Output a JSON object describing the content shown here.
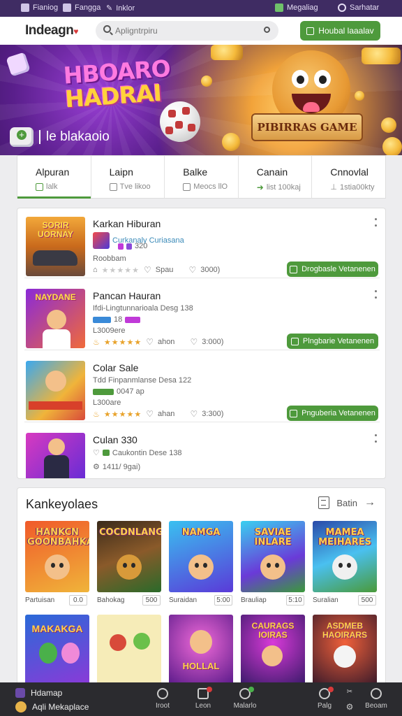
{
  "topbar": {
    "left_items": [
      "Fianiog",
      "Fangga",
      "Inklor"
    ],
    "right_items": [
      "Megaliag",
      "Sarhatar"
    ]
  },
  "header": {
    "logo": "Indeagn",
    "search_placeholder": "Apligntrpiru",
    "action_button": "Houbal laaalav"
  },
  "banner": {
    "title_line1": "HBOARO",
    "title_line2": "HADRAI",
    "tagline": "le blakaoio",
    "ribbon_text": "PIBIRRAS GAME"
  },
  "tabs": [
    {
      "label": "Alpuran",
      "sub": "lalk"
    },
    {
      "label": "Laipn",
      "sub": "Tve likoo"
    },
    {
      "label": "Balke",
      "sub": "Meocs llO"
    },
    {
      "label": "Canain",
      "sub": "list 100kaj"
    },
    {
      "label": "Cnnovlal",
      "sub": "1stia00kty"
    }
  ],
  "listings": [
    {
      "title": "Karkan Hiburan",
      "thumb_text": "SORIR UORNAY",
      "studio": "Curkanaly Curiasana",
      "tag_value": "320",
      "line3": "Roobbam",
      "likes": "Spau",
      "views": "3000)",
      "action": "Drogbasle Vetanenen"
    },
    {
      "title": "Pancan Hauran",
      "thumb_text": "NAYDANE",
      "studio": "Ifdi-Lingtunnarioala Desg 138",
      "tag_value": "18",
      "line3": "L3009ere",
      "likes": "ahon",
      "views": "3:000)",
      "action": "Plngbarie Vetanenen"
    },
    {
      "title": "Colar Sale",
      "thumb_text": "",
      "studio": "Tdd Finpanmlanse Desa 122",
      "tag_value": "0047 ap",
      "line3": "L300are",
      "likes": "ahan",
      "views": "3:300)",
      "action": "Pnguberia Vetanenen"
    },
    {
      "title": "Culan 330",
      "thumb_text": "",
      "studio": "Caukontin Dese 138",
      "tag_value": "",
      "line3": "1411/ 9gai)",
      "likes": "",
      "views": "",
      "action": ""
    }
  ],
  "recommended": {
    "heading": "Kankeyolaes",
    "see_all": "Batin",
    "row1": [
      {
        "title": "HANKCN GOONBAHKAIS",
        "label": "Partuisan",
        "badge": "0.0"
      },
      {
        "title": "COCDNLANGS",
        "label": "Bahokag",
        "badge": "500"
      },
      {
        "title": "NAMGA",
        "label": "Suraidan",
        "badge": "5:00"
      },
      {
        "title": "SAVIAE INLARE",
        "label": "Brauliap",
        "badge": "5:10"
      },
      {
        "title": "MAMEA MEIHARES",
        "label": "Suralian",
        "badge": "500"
      }
    ],
    "row2": [
      {
        "title": "MAKAKGA"
      },
      {
        "title": ""
      },
      {
        "title": "HOLLAL"
      },
      {
        "title": "CAURAGS IOIRAS"
      },
      {
        "title": "ASDMEB HAOIRARS"
      }
    ]
  },
  "bottombar": {
    "brand": "Hdamap",
    "app_name": "Aqli Mekaplace",
    "nav": [
      "Iroot",
      "Leon",
      "Malarlo",
      "Palg"
    ],
    "last_nav_label": "Beoam"
  },
  "colors": {
    "accent_green": "#4e9a3c",
    "topbar_purple": "#3f2c63",
    "star": "#e8a22a"
  }
}
